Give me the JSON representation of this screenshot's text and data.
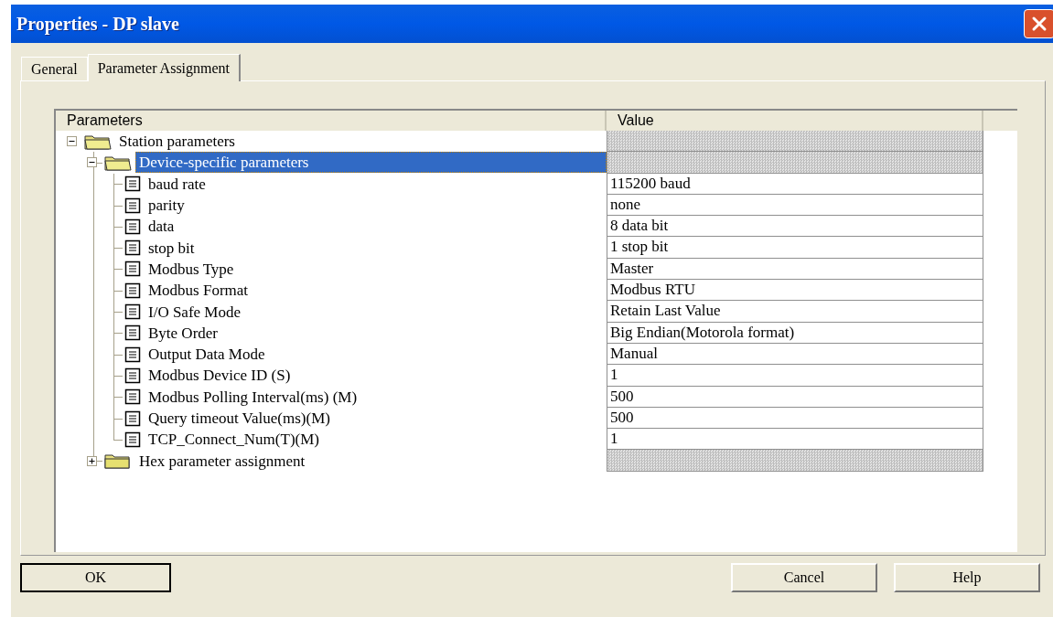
{
  "window": {
    "title": "Properties - DP slave"
  },
  "tabs": [
    {
      "label": "General",
      "selected": false
    },
    {
      "label": "Parameter Assignment",
      "selected": true
    }
  ],
  "table": {
    "columns": [
      "Parameters",
      "Value"
    ],
    "tree": [
      {
        "label": "Station parameters",
        "expanded": true,
        "selected": false,
        "children": [
          {
            "label": "Device-specific parameters",
            "expanded": true,
            "selected": true,
            "children": [
              {
                "label": "baud rate",
                "value": "115200 baud",
                "selected": false
              },
              {
                "label": "parity",
                "value": "none",
                "selected": false
              },
              {
                "label": "data",
                "value": "8 data bit",
                "selected": false
              },
              {
                "label": "stop bit",
                "value": "1 stop bit",
                "selected": false
              },
              {
                "label": "Modbus Type",
                "value": "Master",
                "selected": false
              },
              {
                "label": "Modbus Format",
                "value": "Modbus RTU",
                "selected": false
              },
              {
                "label": "I/O Safe Mode",
                "value": "Retain Last Value",
                "selected": false
              },
              {
                "label": "Byte Order",
                "value": "Big Endian(Motorola  format)",
                "selected": false
              },
              {
                "label": "Output Data Mode",
                "value": "Manual",
                "selected": false
              },
              {
                "label": "Modbus Device ID (S)",
                "value": "1",
                "selected": false
              },
              {
                "label": "Modbus Polling Interval(ms) (M)",
                "value": "500",
                "selected": false
              },
              {
                "label": "Query timeout Value(ms)(M)",
                "value": "500",
                "selected": false
              },
              {
                "label": "TCP_Connect_Num(T)(M)",
                "value": "1",
                "selected": false
              }
            ]
          },
          {
            "label": "Hex parameter assignment",
            "expanded": false,
            "selected": false
          }
        ]
      }
    ]
  },
  "buttons": [
    {
      "label": "OK",
      "default": true
    },
    {
      "label": "Cancel",
      "default": false
    },
    {
      "label": "Help",
      "default": false
    }
  ]
}
